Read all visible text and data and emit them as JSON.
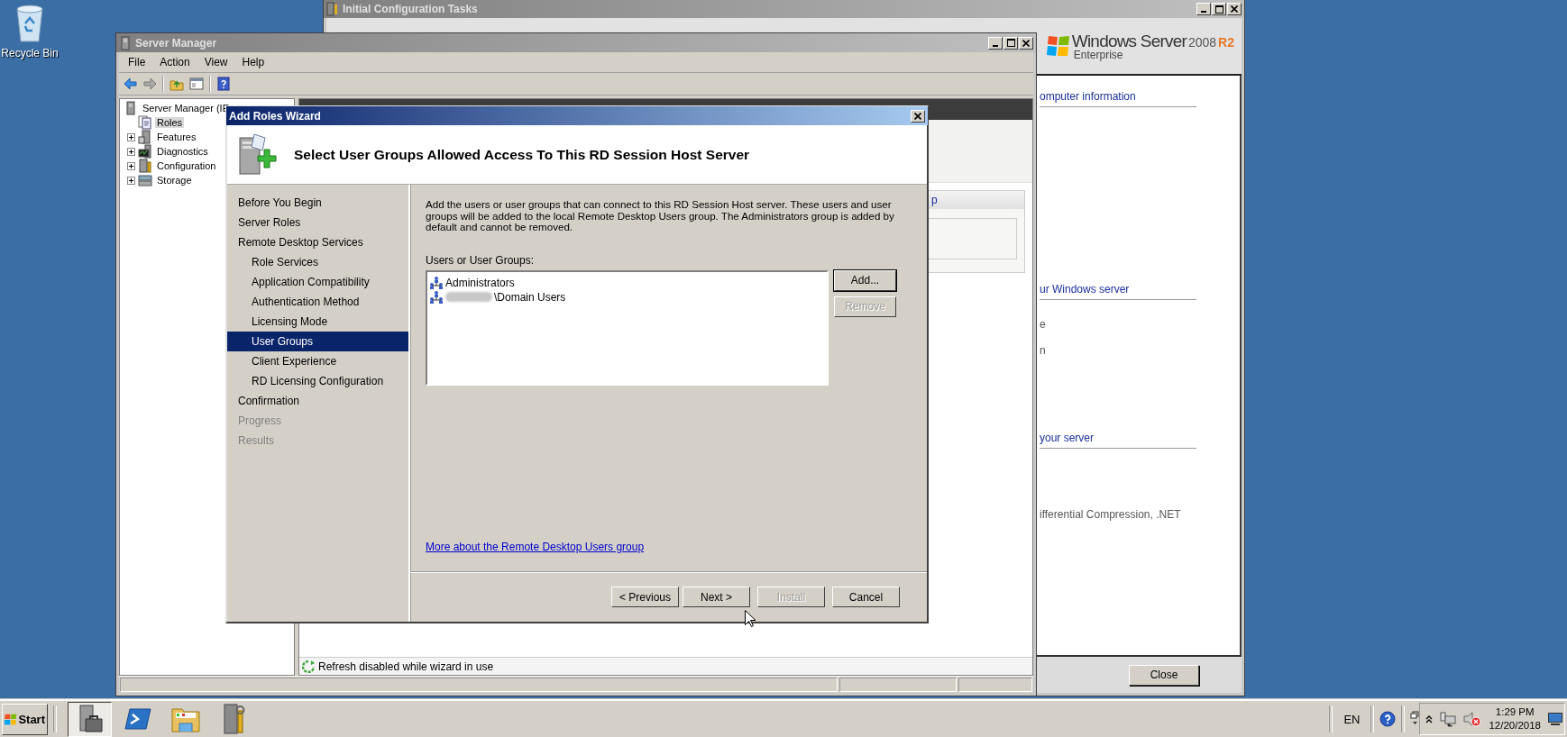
{
  "desktop": {
    "icons": [
      {
        "label": "Recycle Bin"
      }
    ]
  },
  "config_window": {
    "title": "Initial Configuration Tasks",
    "brand": {
      "name": "Windows Server",
      "version": "2008",
      "release": "R2",
      "edition": "Enterprise"
    },
    "sections": [
      {
        "heading": "omputer information"
      },
      {
        "heading": "ur Windows server",
        "lines": [
          "e",
          "n"
        ]
      },
      {
        "heading": "your server",
        "lines": [
          "ifferential Compression, .NET"
        ]
      }
    ],
    "close_button": "Close"
  },
  "server_manager": {
    "title": "Server Manager",
    "menu": [
      "File",
      "Action",
      "View",
      "Help"
    ],
    "tree": {
      "label": "Server Manager (IE",
      "children": [
        {
          "label": "Roles",
          "kind": "documents",
          "selected": true,
          "collapsed": false
        },
        {
          "label": "Features",
          "kind": "server",
          "selected": false,
          "collapsed": true
        },
        {
          "label": "Diagnostics",
          "kind": "monitor",
          "selected": false,
          "collapsed": true
        },
        {
          "label": "Configuration",
          "kind": "tools",
          "selected": false,
          "collapsed": true
        },
        {
          "label": "Storage",
          "kind": "disks",
          "selected": false,
          "collapsed": true
        }
      ]
    },
    "pane_fragment": "p",
    "status": "Refresh disabled while wizard in use"
  },
  "wizard": {
    "title": "Add Roles Wizard",
    "heading": "Select User Groups Allowed Access To This RD Session Host Server",
    "steps": [
      {
        "label": "Before You Begin",
        "selected": false,
        "disabled": false
      },
      {
        "label": "Server Roles",
        "selected": false,
        "disabled": false
      },
      {
        "label": "Remote Desktop Services",
        "selected": false,
        "disabled": false,
        "children": [
          {
            "label": "Role Services",
            "selected": false,
            "disabled": false
          },
          {
            "label": "Application Compatibility",
            "selected": false,
            "disabled": false
          },
          {
            "label": "Authentication Method",
            "selected": false,
            "disabled": false
          },
          {
            "label": "Licensing Mode",
            "selected": false,
            "disabled": false
          },
          {
            "label": "User Groups",
            "selected": true,
            "disabled": false
          },
          {
            "label": "Client Experience",
            "selected": false,
            "disabled": false
          },
          {
            "label": "RD Licensing Configuration",
            "selected": false,
            "disabled": false
          }
        ]
      },
      {
        "label": "Confirmation",
        "selected": false,
        "disabled": false
      },
      {
        "label": "Progress",
        "selected": false,
        "disabled": true
      },
      {
        "label": "Results",
        "selected": false,
        "disabled": true
      }
    ],
    "description": "Add the users or user groups that can connect to this RD Session Host server. These users and user groups will be added to the local Remote Desktop Users group. The Administrators group is added by default and cannot be removed.",
    "list_label": "Users or User Groups:",
    "groups": [
      {
        "name": "Administrators",
        "redacted": false
      },
      {
        "name": "\\Domain Users",
        "redacted": true
      }
    ],
    "side_buttons": [
      {
        "label": "Add...",
        "disabled": false,
        "default": true
      },
      {
        "label": "Remove",
        "disabled": true,
        "default": false
      }
    ],
    "link": "More about the Remote Desktop Users group",
    "buttons": [
      {
        "label": "< Previous",
        "disabled": false
      },
      {
        "label": "Next >",
        "disabled": false
      },
      {
        "label": "Install",
        "disabled": true
      },
      {
        "label": "Cancel",
        "disabled": false
      }
    ]
  },
  "taskbar": {
    "start": "Start",
    "pinned": [
      {
        "kind": "toolbox",
        "selected": true
      },
      {
        "kind": "shell",
        "selected": false
      },
      {
        "kind": "folder",
        "selected": false
      },
      {
        "kind": "tools",
        "selected": false
      }
    ],
    "language": "EN",
    "time": "1:29 PM",
    "date": "12/20/2018"
  }
}
